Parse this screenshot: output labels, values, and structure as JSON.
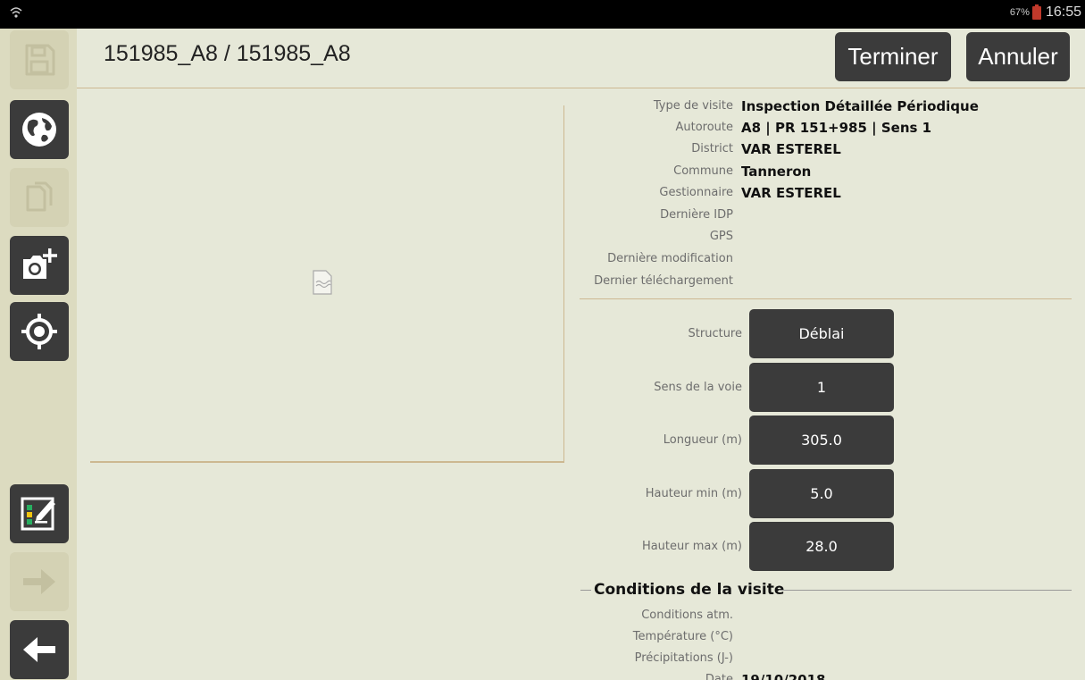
{
  "status_bar": {
    "battery": "67%",
    "time": "16:55"
  },
  "header": {
    "title": "151985_A8 / 151985_A8",
    "finish_label": "Terminer",
    "cancel_label": "Annuler"
  },
  "info": {
    "rows": [
      {
        "label": "Type de visite",
        "value": "Inspection Détaillée Périodique"
      },
      {
        "label": "Autoroute",
        "value": "A8 | PR 151+985 | Sens 1"
      },
      {
        "label": "District",
        "value": "VAR ESTEREL"
      },
      {
        "label": "Commune",
        "value": "Tanneron"
      },
      {
        "label": "Gestionnaire",
        "value": "VAR ESTEREL"
      },
      {
        "label": "Dernière IDP",
        "value": ""
      },
      {
        "label": "GPS",
        "value": ""
      },
      {
        "label": "Dernière modification",
        "value": ""
      },
      {
        "label": "Dernier téléchargement",
        "value": ""
      }
    ]
  },
  "fields": [
    {
      "label": "Structure",
      "value": "Déblai"
    },
    {
      "label": "Sens de la voie",
      "value": "1"
    },
    {
      "label": "Longueur (m)",
      "value": "305.0"
    },
    {
      "label": "Hauteur min (m)",
      "value": "5.0"
    },
    {
      "label": "Hauteur max (m)",
      "value": "28.0"
    }
  ],
  "conditions": {
    "title": "Conditions de la visite",
    "rows": [
      {
        "label": "Conditions atm.",
        "value": ""
      },
      {
        "label": "Température (°C)",
        "value": ""
      },
      {
        "label": "Précipitations (J-)",
        "value": ""
      },
      {
        "label": "Date",
        "value": "19/10/2018"
      }
    ]
  },
  "icons": {
    "wifi": "wifi-icon",
    "save": "save-icon",
    "globe": "globe-icon",
    "copy": "copy-icon",
    "add_photo": "add-photo-icon",
    "locate": "locate-icon",
    "checklist": "checklist-edit-icon",
    "next": "arrow-right-icon",
    "back": "arrow-left-icon",
    "broken_image": "broken-image-icon"
  }
}
